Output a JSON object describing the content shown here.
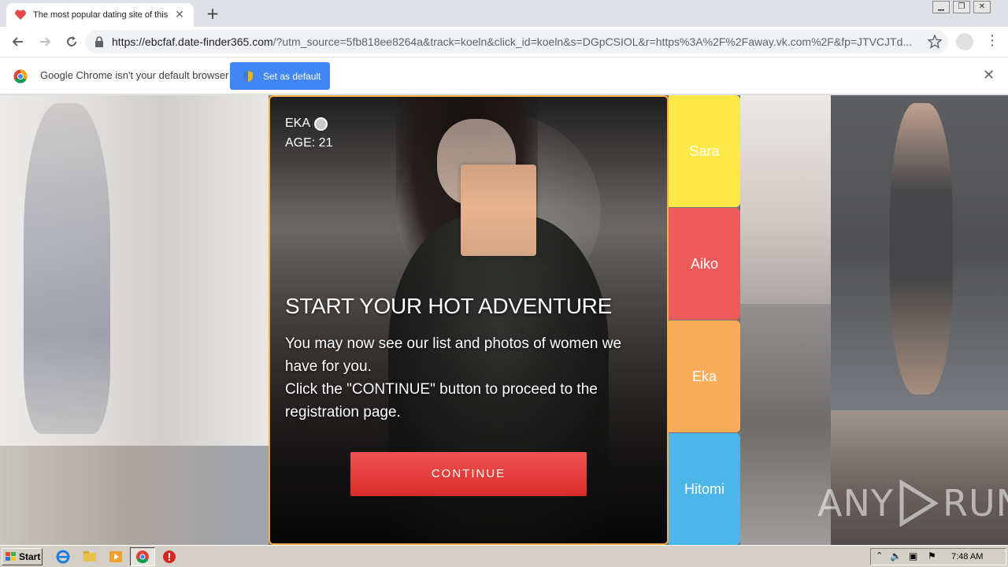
{
  "browser": {
    "tab_title": "The most popular dating site of this m",
    "new_tab_label": "+",
    "url_host": "https://ebcfaf.date-finder365.com",
    "url_path": "/?utm_source=5fb818ee8264a&track=koeln&click_id=koeln&s=DGpCSIOL&r=https%3A%2F%2Faway.vk.com%2F&fp=JTVCJTd...",
    "infobar_message": "Google Chrome isn't your default browser",
    "set_default_label": "Set as default"
  },
  "card": {
    "profile_name": "EKA",
    "age_text": "AGE: 21",
    "heading": "START YOUR HOT ADVENTURE",
    "desc_line1": "You may now see our list and photos of women we have for you.",
    "desc_line2": "Click the \"CONTINUE\" button to proceed to the registration page.",
    "continue_label": "CONTINUE"
  },
  "sidebar": {
    "items": [
      {
        "label": "Sara",
        "color": "#fde84a"
      },
      {
        "label": "Aiko",
        "color": "#ec5a5a"
      },
      {
        "label": "Eka",
        "color": "#f9ad5a"
      },
      {
        "label": "Hitomi",
        "color": "#4db6e8"
      }
    ]
  },
  "watermark": {
    "left": "ANY",
    "right": "RUN"
  },
  "taskbar": {
    "start_label": "Start",
    "clock": "7:48 AM"
  }
}
